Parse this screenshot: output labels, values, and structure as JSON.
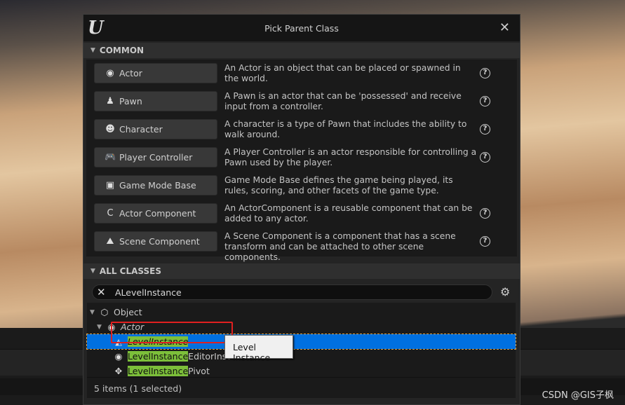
{
  "window": {
    "title": "Pick Parent Class",
    "logo": "U"
  },
  "common": {
    "header": "COMMON",
    "items": [
      {
        "label": "Actor",
        "icon": "actor-icon",
        "glyph": "◉",
        "desc": "An Actor is an object that can be placed or spawned in the world.",
        "help": true
      },
      {
        "label": "Pawn",
        "icon": "pawn-icon",
        "glyph": "♟",
        "desc": "A Pawn is an actor that can be 'possessed' and receive input from a controller.",
        "help": true
      },
      {
        "label": "Character",
        "icon": "character-icon",
        "glyph": "☻",
        "desc": "A character is a type of Pawn that includes the ability to walk around.",
        "help": true
      },
      {
        "label": "Player Controller",
        "icon": "gamepad-icon",
        "glyph": "🎮",
        "desc": "A Player Controller is an actor responsible for controlling a Pawn used by the player.",
        "help": true
      },
      {
        "label": "Game Mode Base",
        "icon": "game-mode-icon",
        "glyph": "▣",
        "desc": "Game Mode Base defines the game being played, its rules, scoring, and other facets of the game type.",
        "help": false
      },
      {
        "label": "Actor Component",
        "icon": "component-icon",
        "glyph": "C",
        "desc": "An ActorComponent is a reusable component that can be added to any actor.",
        "help": true
      },
      {
        "label": "Scene Component",
        "icon": "scene-component-icon",
        "glyph": "⛰",
        "desc": "A Scene Component is a component that has a scene transform and can be attached to other scene components.",
        "help": true
      }
    ]
  },
  "all_classes": {
    "header": "ALL CLASSES",
    "search_value": "ALevelInstance",
    "tree": {
      "object": "Object",
      "actor": "Actor",
      "items": [
        {
          "match": "LevelInstance",
          "rest": "",
          "italic": true,
          "selected": true
        },
        {
          "match": "LevelInstance",
          "rest": "EditorInst",
          "italic": false,
          "selected": false
        },
        {
          "match": "LevelInstance",
          "rest": "Pivot",
          "italic": false,
          "selected": false
        }
      ]
    },
    "status": "5 items (1 selected)"
  },
  "tooltip": "Level Instance",
  "watermark": "CSDN @GIS子枫",
  "colors": {
    "selection": "#0070e0",
    "highlight": "#7cbf3a",
    "annotation": "#e02020"
  }
}
